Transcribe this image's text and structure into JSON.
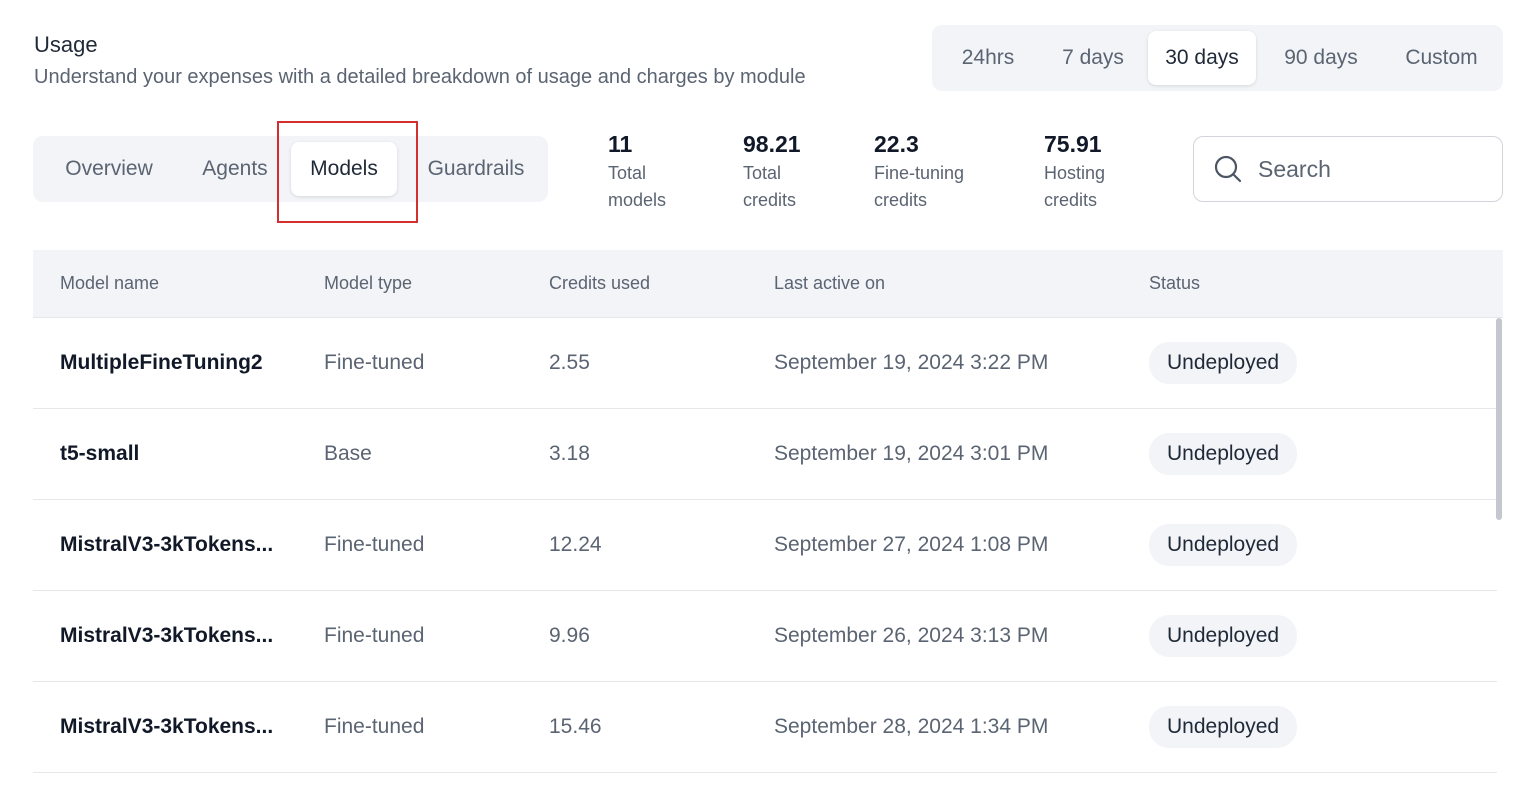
{
  "header": {
    "title": "Usage",
    "subtitle": "Understand your expenses with a detailed breakdown of usage and charges by module"
  },
  "time_range": {
    "options": [
      "24hrs",
      "7 days",
      "30 days",
      "90 days",
      "Custom"
    ],
    "selected": "30 days"
  },
  "tabs": {
    "items": [
      "Overview",
      "Agents",
      "Models",
      "Guardrails"
    ],
    "selected": "Models"
  },
  "stats": [
    {
      "value": "11",
      "label": "Total\nmodels"
    },
    {
      "value": "98.21",
      "label": "Total\ncredits"
    },
    {
      "value": "22.3",
      "label": "Fine-tuning\ncredits"
    },
    {
      "value": "75.91",
      "label": "Hosting\ncredits"
    }
  ],
  "search": {
    "placeholder": "Search",
    "icon": "search-icon"
  },
  "table": {
    "columns": [
      "Model name",
      "Model type",
      "Credits used",
      "Last active on",
      "Status"
    ],
    "rows": [
      {
        "name": "MultipleFineTuning2",
        "type": "Fine-tuned",
        "credits": "2.55",
        "last_active": "September 19, 2024 3:22 PM",
        "status": "Undeployed"
      },
      {
        "name": "t5-small",
        "type": "Base",
        "credits": "3.18",
        "last_active": "September 19, 2024 3:01 PM",
        "status": "Undeployed"
      },
      {
        "name": "MistralV3-3kTokens...",
        "type": "Fine-tuned",
        "credits": "12.24",
        "last_active": "September 27, 2024 1:08 PM",
        "status": "Undeployed"
      },
      {
        "name": "MistralV3-3kTokens...",
        "type": "Fine-tuned",
        "credits": "9.96",
        "last_active": "September 26, 2024 3:13 PM",
        "status": "Undeployed"
      },
      {
        "name": "MistralV3-3kTokens...",
        "type": "Fine-tuned",
        "credits": "15.46",
        "last_active": "September 28, 2024 1:34 PM",
        "status": "Undeployed"
      }
    ]
  },
  "colors": {
    "highlight": "#d32f2f",
    "surface": "#f2f4f7",
    "muted_text": "#5b6472"
  }
}
